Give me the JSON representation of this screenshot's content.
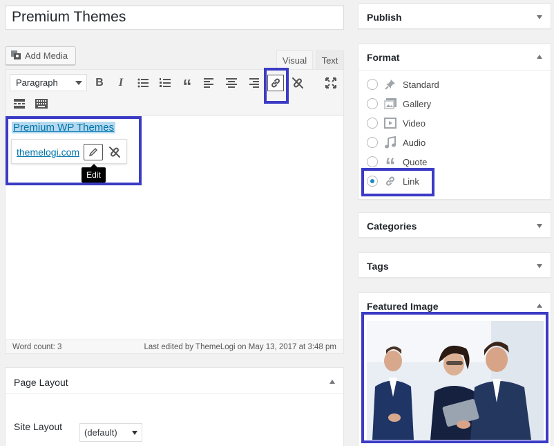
{
  "post": {
    "title": "Premium Themes",
    "add_media_label": "Add Media",
    "tabs": {
      "visual": "Visual",
      "text": "Text"
    },
    "format_select": "Paragraph",
    "content_link_text": "Premium WP Themes",
    "link_popup_url": "themelogi.com",
    "edit_tooltip": "Edit",
    "word_count": "Word count: 3",
    "last_edited": "Last edited by ThemeLogi on May 13, 2017 at 3:48 pm"
  },
  "page_layout": {
    "title": "Page Layout",
    "site_layout_label": "Site Layout",
    "site_layout_value": "(default)"
  },
  "sidebar": {
    "publish": "Publish",
    "format": {
      "title": "Format",
      "options": [
        {
          "label": "Standard",
          "icon": "pin-icon"
        },
        {
          "label": "Gallery",
          "icon": "gallery-icon"
        },
        {
          "label": "Video",
          "icon": "video-icon"
        },
        {
          "label": "Audio",
          "icon": "audio-icon"
        },
        {
          "label": "Quote",
          "icon": "quote-icon"
        },
        {
          "label": "Link",
          "icon": "link-icon"
        }
      ],
      "selected": "Link"
    },
    "categories": "Categories",
    "tags": "Tags",
    "featured_image": "Featured Image"
  },
  "colors": {
    "accent": "#0073aa",
    "highlight_box": "#3b3bc5",
    "radio_checked": "#1e8cbe"
  }
}
